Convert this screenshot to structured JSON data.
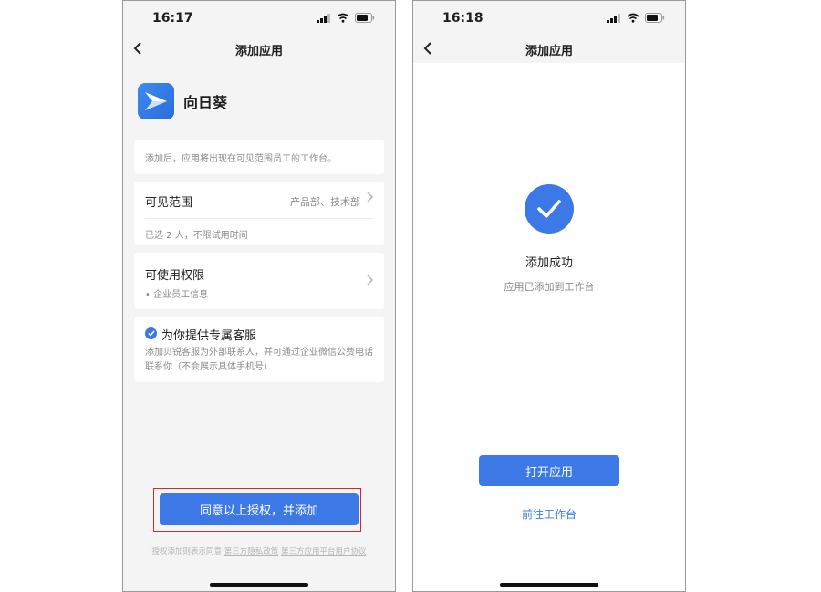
{
  "screen_left": {
    "status_time": "16:17",
    "nav_title": "添加应用",
    "app_name": "向日葵",
    "notice": "添加后，应用将出现在可见范围员工的工作台。",
    "scope": {
      "label": "可见范围",
      "value": "产品部、技术部",
      "sub": "已选 2 人，不限试用时间"
    },
    "permissions": {
      "label": "可使用权限",
      "item": "• 企业员工信息"
    },
    "service": {
      "title": "为你提供专属客服",
      "desc": "添加贝锐客服为外部联系人，并可通过企业微信公费电话联系你（不会展示具体手机号）",
      "checked": true
    },
    "primary_button": "同意以上授权，并添加",
    "agreement": {
      "prefix": "授权添加则表示同意 ",
      "link1": "第三方隐私政策",
      "link2": "第三方应用平台用户协议"
    }
  },
  "screen_right": {
    "status_time": "16:18",
    "nav_title": "添加应用",
    "success_title": "添加成功",
    "success_sub": "应用已添加到工作台",
    "open_button": "打开应用",
    "goto_link": "前往工作台"
  },
  "icons": {
    "back": "chevron-left-icon",
    "signal": "signal-icon",
    "wifi": "wifi-icon",
    "battery": "battery-icon",
    "chevron": "chevron-right-icon",
    "check": "check-circle-icon",
    "success": "success-check-icon",
    "app_logo": "sunflower-logo-icon"
  },
  "colors": {
    "accent": "#3d79e6",
    "highlight_box": "#d22a2a",
    "background": "#f4f4f4"
  }
}
